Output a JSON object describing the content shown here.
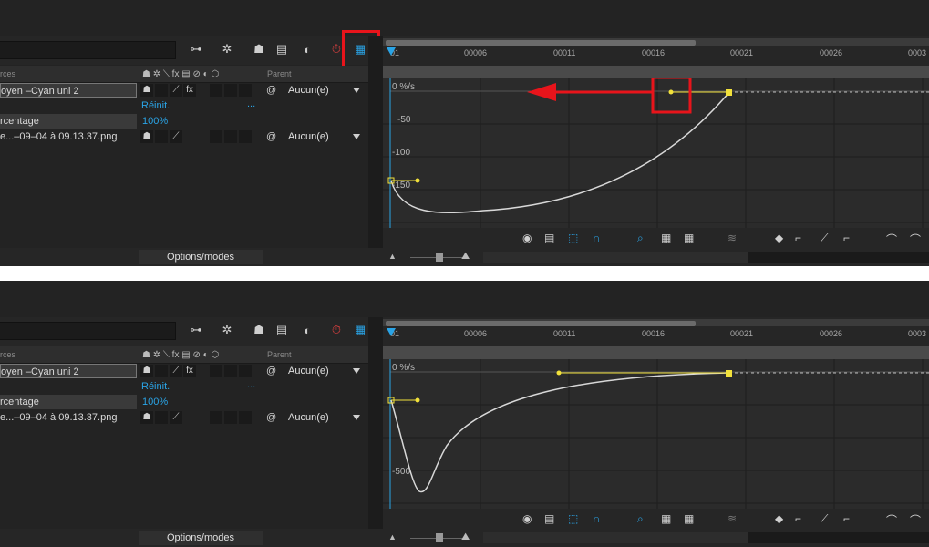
{
  "panels": [
    {
      "id": "top",
      "col_headers": {
        "sources": "rces",
        "parent": "Parent"
      },
      "layers": [
        {
          "name": "oyen –Cyan uni 2",
          "parent": "Aucun(e)"
        },
        {
          "name": "",
          "reset": "Réinit.",
          "dots": "..."
        },
        {
          "name": "rcentage",
          "value": "100%"
        },
        {
          "name": "e...–09–04 à 09.13.37.png",
          "parent": "Aucun(e)"
        }
      ],
      "ticks": [
        "01",
        "00006",
        "00011",
        "00016",
        "00021",
        "00026",
        "0003"
      ],
      "y_labels": [
        "0 %/s",
        "-50",
        "-100",
        "-150"
      ],
      "options_label": "Options/modes"
    },
    {
      "id": "bottom",
      "col_headers": {
        "sources": "rces",
        "parent": "Parent"
      },
      "layers": [
        {
          "name": "oyen –Cyan uni 2",
          "parent": "Aucun(e)"
        },
        {
          "name": "",
          "reset": "Réinit.",
          "dots": "..."
        },
        {
          "name": "rcentage",
          "value": "100%"
        },
        {
          "name": "e...–09–04 à 09.13.37.png",
          "parent": "Aucun(e)"
        }
      ],
      "ticks": [
        "01",
        "00006",
        "00011",
        "00016",
        "00021",
        "00026",
        "0003"
      ],
      "y_labels": [
        "0 %/s",
        "-500"
      ],
      "options_label": "Options/modes"
    }
  ],
  "colors": {
    "accent": "#2aa4e6",
    "highlight": "#e8141b",
    "keyframe": "#f2e13b"
  }
}
